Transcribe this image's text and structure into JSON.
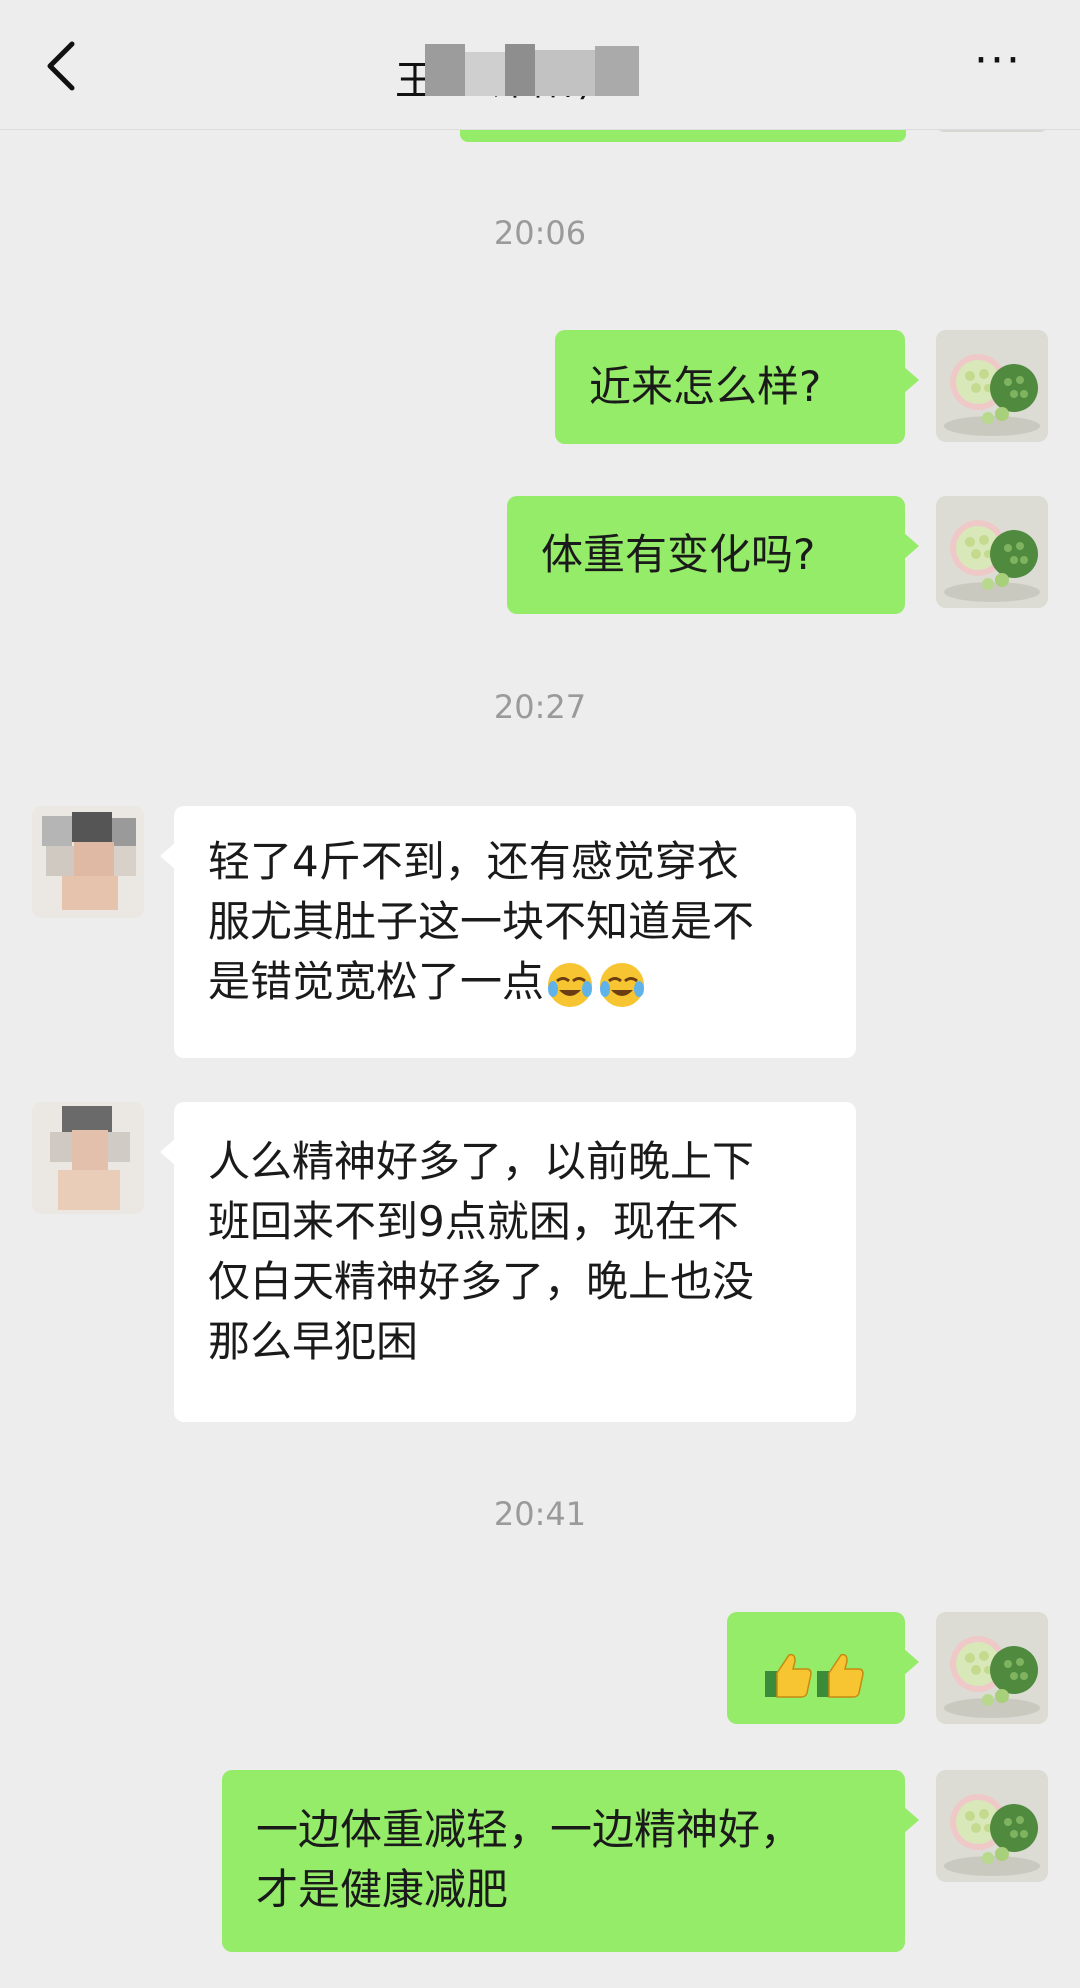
{
  "header": {
    "title": "王 · 谭阳)",
    "more_label": "···",
    "back_icon": "chevron-left-icon"
  },
  "colors": {
    "background": "#ededed",
    "outgoing_bubble": "#95ec69",
    "incoming_bubble": "#ffffff",
    "timestamp": "#9a9a9a"
  },
  "messages": [
    {
      "type": "time",
      "text": "20:06"
    },
    {
      "type": "outgoing",
      "text": "近来怎么样?"
    },
    {
      "type": "outgoing",
      "text": "体重有变化吗?"
    },
    {
      "type": "time",
      "text": "20:27"
    },
    {
      "type": "incoming",
      "lines": [
        "轻了4斤不到，还有感觉穿衣",
        "服尤其肚子这一块不知道是不",
        "是错觉宽松了一点"
      ],
      "emoji": "crying-laughing-emoji"
    },
    {
      "type": "incoming",
      "lines": [
        "人么精神好多了，以前晚上下",
        "班回来不到9点就困，现在不",
        "仅白天精神好多了，晚上也没",
        "那么早犯困"
      ]
    },
    {
      "type": "time",
      "text": "20:41"
    },
    {
      "type": "outgoing",
      "emoji": "thumbs-up-emoji"
    },
    {
      "type": "outgoing",
      "lines": [
        "一边体重减轻，一边精神好，",
        "才是健康减肥"
      ]
    }
  ]
}
